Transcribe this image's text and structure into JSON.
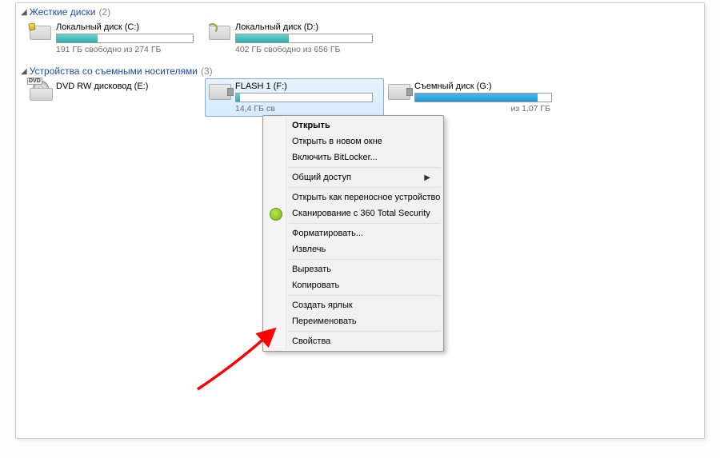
{
  "groups": {
    "hdd": {
      "title": "Жесткие диски",
      "count": "(2)"
    },
    "removable": {
      "title": "Устройства со съемными носителями",
      "count": "(3)"
    }
  },
  "drives": {
    "c": {
      "name": "Локальный диск (C:)",
      "cap": "191 ГБ свободно из 274 ГБ",
      "fill": 30
    },
    "d": {
      "name": "Локальный диск (D:)",
      "cap": "402 ГБ свободно из 656 ГБ",
      "fill": 39
    },
    "dvd": {
      "name": "DVD RW дисковод (E:)"
    },
    "flash": {
      "name": "FLASH 1 (F:)",
      "cap": "14,4 ГБ св",
      "fill": 3
    },
    "g": {
      "name": "Съемный диск (G:)",
      "cap_tail": "из 1,07 ГБ",
      "fill": 90
    }
  },
  "menu": {
    "open": "Открыть",
    "open_new": "Открыть в новом окне",
    "bitlocker": "Включить BitLocker...",
    "share": "Общий доступ",
    "portable": "Открыть как переносное устройство",
    "scan360": "Сканирование с 360 Total Security",
    "format": "Форматировать...",
    "eject": "Извлечь",
    "cut": "Вырезать",
    "copy": "Копировать",
    "shortcut": "Создать ярлык",
    "rename": "Переименовать",
    "properties": "Свойства"
  }
}
